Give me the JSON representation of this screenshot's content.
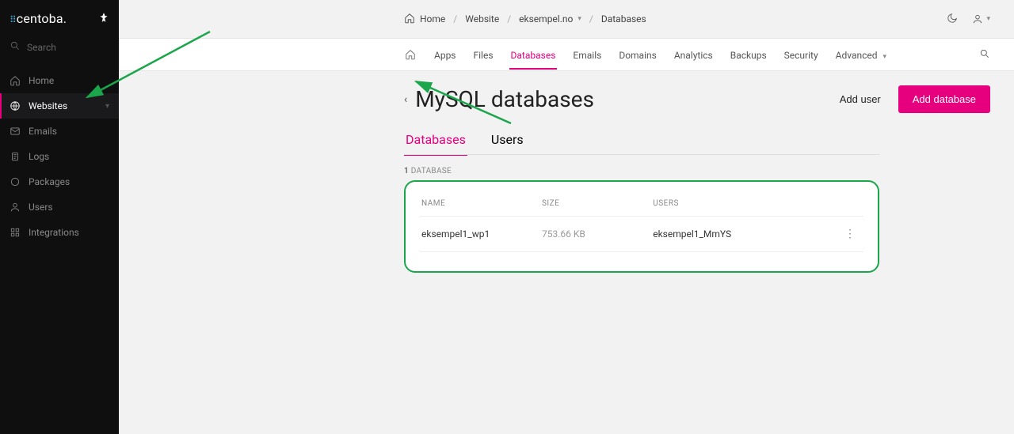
{
  "brand": {
    "name": "centoba."
  },
  "sidebar": {
    "search_placeholder": "Search",
    "items": [
      {
        "label": "Home",
        "icon": "home-icon"
      },
      {
        "label": "Websites",
        "icon": "globe-icon",
        "active": true,
        "expandable": true
      },
      {
        "label": "Emails",
        "icon": "mail-icon"
      },
      {
        "label": "Logs",
        "icon": "clipboard-icon"
      },
      {
        "label": "Packages",
        "icon": "circle-icon"
      },
      {
        "label": "Users",
        "icon": "user-icon"
      },
      {
        "label": "Integrations",
        "icon": "grid-icon"
      }
    ]
  },
  "breadcrumb": {
    "items": [
      {
        "label": "Home"
      },
      {
        "label": "Website"
      },
      {
        "label": "eksempel.no",
        "dropdown": true
      },
      {
        "label": "Databases"
      }
    ]
  },
  "section_tabs": {
    "items": [
      {
        "label": "Apps"
      },
      {
        "label": "Files"
      },
      {
        "label": "Databases",
        "active": true
      },
      {
        "label": "Emails"
      },
      {
        "label": "Domains"
      },
      {
        "label": "Analytics"
      },
      {
        "label": "Backups"
      },
      {
        "label": "Security"
      },
      {
        "label": "Advanced",
        "dropdown": true
      }
    ]
  },
  "page": {
    "title": "MySQL databases",
    "add_user_label": "Add user",
    "add_db_label": "Add database"
  },
  "subtabs": {
    "items": [
      {
        "label": "Databases",
        "active": true
      },
      {
        "label": "Users"
      }
    ]
  },
  "table": {
    "count_number": "1",
    "count_label": "DATABASE",
    "columns": {
      "name": "NAME",
      "size": "SIZE",
      "users": "USERS"
    },
    "rows": [
      {
        "name": "eksempel1_wp1",
        "size": "753.66 KB",
        "users": "eksempel1_MmYS"
      }
    ]
  }
}
